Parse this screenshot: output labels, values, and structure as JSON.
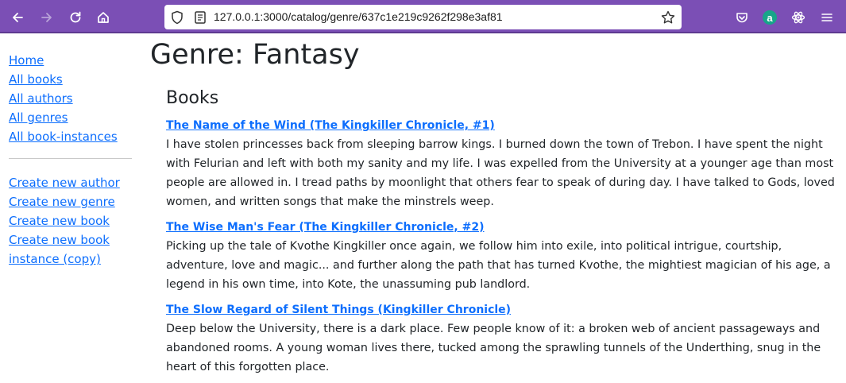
{
  "browser": {
    "url": "127.0.0.1:3000/catalog/genre/637c1e219c9262f298e3af81",
    "extension_avatar_letter": "a",
    "colors": {
      "toolbar": "#7b4fb5",
      "link": "#0d6efd",
      "text": "#212529"
    },
    "icons": [
      "back-icon",
      "forward-icon",
      "reload-icon",
      "home-icon",
      "shield-icon",
      "page-info-icon",
      "bookmark-star-icon",
      "pocket-icon",
      "extension-avatar-icon",
      "react-devtools-icon",
      "menu-icon"
    ]
  },
  "sidebar": {
    "nav_links": [
      "Home",
      "All books",
      "All authors",
      "All genres",
      "All book-instances"
    ],
    "create_links": [
      "Create new author",
      "Create new genre",
      "Create new book",
      "Create new book instance (copy)"
    ]
  },
  "main": {
    "title": "Genre: Fantasy",
    "books_heading": "Books",
    "books": [
      {
        "title": "The Name of the Wind (The Kingkiller Chronicle, #1)",
        "summary": "I have stolen princesses back from sleeping barrow kings. I burned down the town of Trebon. I have spent the night with Felurian and left with both my sanity and my life. I was expelled from the University at a younger age than most people are allowed in. I tread paths by moonlight that others fear to speak of during day. I have talked to Gods, loved women, and written songs that make the minstrels weep."
      },
      {
        "title": "The Wise Man's Fear (The Kingkiller Chronicle, #2)",
        "summary": "Picking up the tale of Kvothe Kingkiller once again, we follow him into exile, into political intrigue, courtship, adventure, love and magic... and further along the path that has turned Kvothe, the mightiest magician of his age, a legend in his own time, into Kote, the unassuming pub landlord."
      },
      {
        "title": "The Slow Regard of Silent Things (Kingkiller Chronicle)",
        "summary": "Deep below the University, there is a dark place. Few people know of it: a broken web of ancient passageways and abandoned rooms. A young woman lives there, tucked among the sprawling tunnels of the Underthing, snug in the heart of this forgotten place."
      }
    ]
  }
}
